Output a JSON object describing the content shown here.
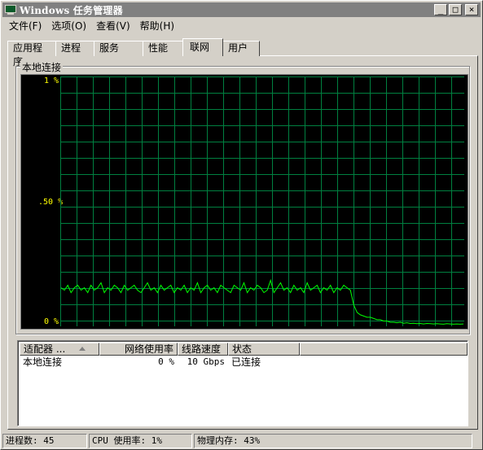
{
  "window": {
    "title": "Windows 任务管理器",
    "controls": {
      "minimize": "_",
      "maximize": "□",
      "close": "×"
    }
  },
  "menu": [
    {
      "label": "文件(F)"
    },
    {
      "label": "选项(O)"
    },
    {
      "label": "查看(V)"
    },
    {
      "label": "帮助(H)"
    }
  ],
  "tabs": [
    {
      "label": "应用程序",
      "active": false
    },
    {
      "label": "进程",
      "active": false
    },
    {
      "label": "服务",
      "active": false
    },
    {
      "label": "性能",
      "active": false
    },
    {
      "label": "联网",
      "active": true
    },
    {
      "label": "用户",
      "active": false
    }
  ],
  "group": {
    "label": "本地连接",
    "graph": {
      "y_labels": {
        "top": "1 %",
        "mid": ".50 %",
        "bottom": "0 %"
      },
      "colors": {
        "background": "#000000",
        "grid": "#008040",
        "line": "#00ff00",
        "label": "#ffff00"
      }
    }
  },
  "chart_data": {
    "type": "line",
    "title": "本地连接",
    "xlabel": "",
    "ylabel": "",
    "ylim": [
      0,
      1
    ],
    "yticks": [
      "1 %",
      ".50 %",
      "0 %"
    ],
    "grid": true,
    "series": [
      {
        "values": [
          0.15,
          0.14,
          0.16,
          0.13,
          0.15,
          0.16,
          0.14,
          0.15,
          0.13,
          0.16,
          0.14,
          0.15,
          0.17,
          0.13,
          0.15,
          0.14,
          0.16,
          0.15,
          0.13,
          0.16,
          0.14,
          0.15,
          0.16,
          0.14,
          0.13,
          0.15,
          0.17,
          0.14,
          0.15,
          0.13,
          0.16,
          0.14,
          0.15,
          0.16,
          0.13,
          0.15,
          0.14,
          0.16,
          0.13,
          0.15,
          0.14,
          0.17,
          0.13,
          0.15,
          0.16,
          0.14,
          0.15,
          0.13,
          0.16,
          0.15,
          0.14,
          0.13,
          0.16,
          0.15,
          0.14,
          0.17,
          0.13,
          0.15,
          0.14,
          0.16,
          0.15,
          0.13,
          0.14,
          0.18,
          0.13,
          0.15,
          0.17,
          0.14,
          0.15,
          0.13,
          0.16,
          0.14,
          0.15,
          0.13,
          0.17,
          0.14,
          0.15,
          0.16,
          0.13,
          0.15,
          0.14,
          0.16,
          0.13,
          0.15,
          0.14,
          0.16,
          0.15,
          0.14,
          0.08,
          0.05,
          0.04,
          0.035,
          0.03,
          0.03,
          0.025,
          0.02,
          0.02,
          0.015,
          0.015,
          0.01,
          0.01,
          0.008,
          0.01,
          0.006,
          0.008,
          0.005,
          0.006,
          0.004,
          0.005,
          0.003,
          0.005,
          0.004,
          0.003,
          0.004,
          0.003,
          0.002,
          0.004,
          0.003,
          0.002,
          0.003,
          0.002,
          0.003
        ]
      }
    ]
  },
  "adapters": {
    "columns": [
      {
        "label": "适配器 ..."
      },
      {
        "label": "网络使用率"
      },
      {
        "label": "线路速度"
      },
      {
        "label": "状态"
      },
      {
        "label": ""
      }
    ],
    "rows": [
      {
        "name": "本地连接",
        "usage": "0 %",
        "speed": "10 Gbps",
        "state": "已连接"
      }
    ]
  },
  "status": {
    "processes": "进程数: 45",
    "cpu": "CPU 使用率: 1%",
    "memory": "物理内存: 43%"
  }
}
